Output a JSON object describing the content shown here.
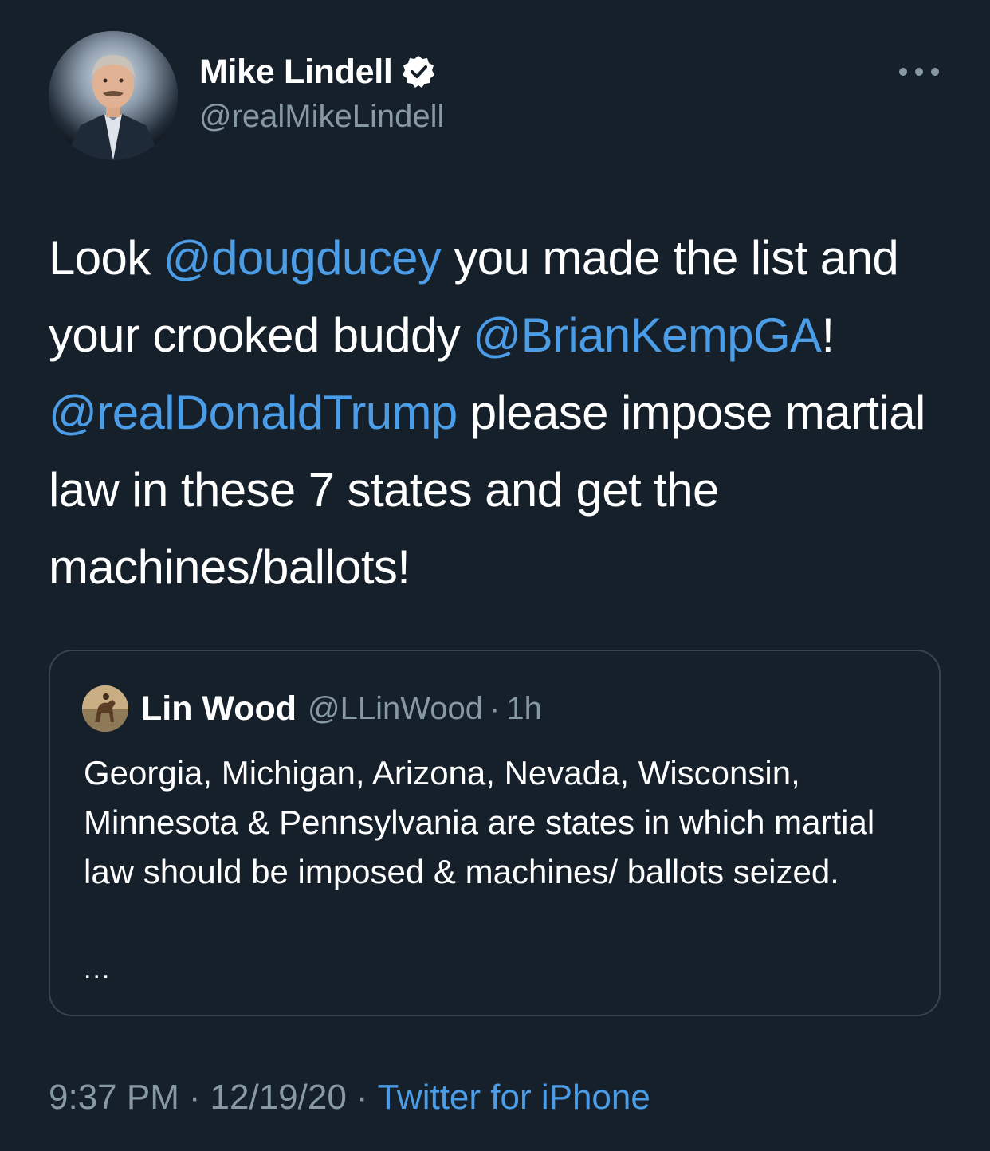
{
  "author": {
    "display_name": "Mike Lindell",
    "handle": "@realMikeLindell",
    "verified_icon": "verified-badge-icon",
    "avatar_icon": "profile-photo"
  },
  "more_icon": "more-options-icon",
  "tweet": {
    "segments": [
      {
        "text": "Look ",
        "mention": false
      },
      {
        "text": "@dougducey",
        "mention": true
      },
      {
        "text": " you made the list and your crooked buddy ",
        "mention": false
      },
      {
        "text": "@BrianKempGA",
        "mention": true
      },
      {
        "text": "! ",
        "mention": false
      },
      {
        "text": "@realDonaldTrump",
        "mention": true
      },
      {
        "text": " please impose martial law in these 7 states and get the machines/ballots!",
        "mention": false
      }
    ]
  },
  "quote": {
    "display_name": "Lin Wood",
    "handle": "@LLinWood",
    "separator": "·",
    "time": "1h",
    "text": "Georgia, Michigan, Arizona, Nevada, Wisconsin, Minnesota & Pennsylvania are states in which martial law should be imposed & machines/ ballots seized.",
    "more": "..."
  },
  "footer": {
    "time": "9:37 PM",
    "separator": "·",
    "date": "12/19/20",
    "source": "Twitter for iPhone"
  },
  "colors": {
    "background": "#15202b",
    "link": "#4a9de6",
    "secondary_text": "#8899a6",
    "border": "#38444d"
  }
}
